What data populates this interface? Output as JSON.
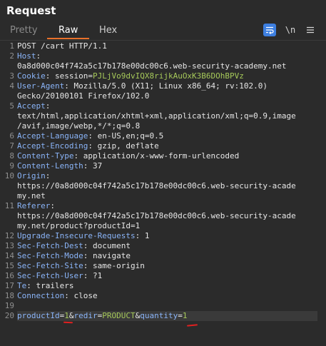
{
  "panel": {
    "title": "Request"
  },
  "tabs": [
    {
      "label": "Pretty",
      "active": false
    },
    {
      "label": "Raw",
      "active": true
    },
    {
      "label": "Hex",
      "active": false
    }
  ],
  "toolbar": {
    "wrap_icon": "text-wrap-icon",
    "newline_label": "\\n",
    "menu_icon": "hamburger-menu-icon"
  },
  "colors": {
    "accent": "#e8702a",
    "header_name": "#8ab4f8",
    "highlight": "#a6c95a",
    "annotation": "#e02020"
  },
  "request": {
    "request_line": "POST /cart HTTP/1.1",
    "host_name": "Host",
    "host_value": "0a8d000c04f742a5c17b178e00dc00c6.web-security-academy.net",
    "cookie_name": "Cookie",
    "cookie_key": "session",
    "cookie_value": "PJLjVo9dvIQX8rijkAuOxK3B6DOhBPVz",
    "ua_name": "User-Agent",
    "ua_value_1": "Mozilla/5.0 (X11; Linux x86_64; rv:102.0)",
    "ua_value_2": "Gecko/20100101 Firefox/102.0",
    "accept_name": "Accept",
    "accept_value_1": "text/html,application/xhtml+xml,application/xml;q=0.9,image",
    "accept_value_2": "/avif,image/webp,*/*;q=0.8",
    "accept_language_name": "Accept-Language",
    "accept_language_value": "en-US,en;q=0.5",
    "accept_encoding_name": "Accept-Encoding",
    "accept_encoding_value": "gzip, deflate",
    "content_type_name": "Content-Type",
    "content_type_value": "application/x-www-form-urlencoded",
    "content_length_name": "Content-Length",
    "content_length_value": "37",
    "origin_name": "Origin",
    "origin_value_1": "https://0a8d000c04f742a5c17b178e00dc00c6.web-security-acade",
    "origin_value_2": "my.net",
    "referer_name": "Referer",
    "referer_value_1": "https://0a8d000c04f742a5c17b178e00dc00c6.web-security-acade",
    "referer_value_2": "my.net/product?productId=1",
    "uir_name": "Upgrade-Insecure-Requests",
    "uir_value": "1",
    "sfd_name": "Sec-Fetch-Dest",
    "sfd_value": "document",
    "sfm_name": "Sec-Fetch-Mode",
    "sfm_value": "navigate",
    "sfs_name": "Sec-Fetch-Site",
    "sfs_value": "same-origin",
    "sfu_name": "Sec-Fetch-User",
    "sfu_value": "?1",
    "te_name": "Te",
    "te_value": "trailers",
    "connection_name": "Connection",
    "connection_value": "close",
    "body": {
      "p1_name": "productId",
      "p1_value": "1",
      "p2_name": "redir",
      "p2_value": "PRODUCT",
      "p3_name": "quantity",
      "p3_value": "1"
    }
  },
  "line_numbers": [
    "1",
    "2",
    "3",
    "4",
    "5",
    "6",
    "7",
    "8",
    "9",
    "10",
    "11",
    "12",
    "13",
    "14",
    "15",
    "16",
    "17",
    "18",
    "19",
    "20"
  ]
}
